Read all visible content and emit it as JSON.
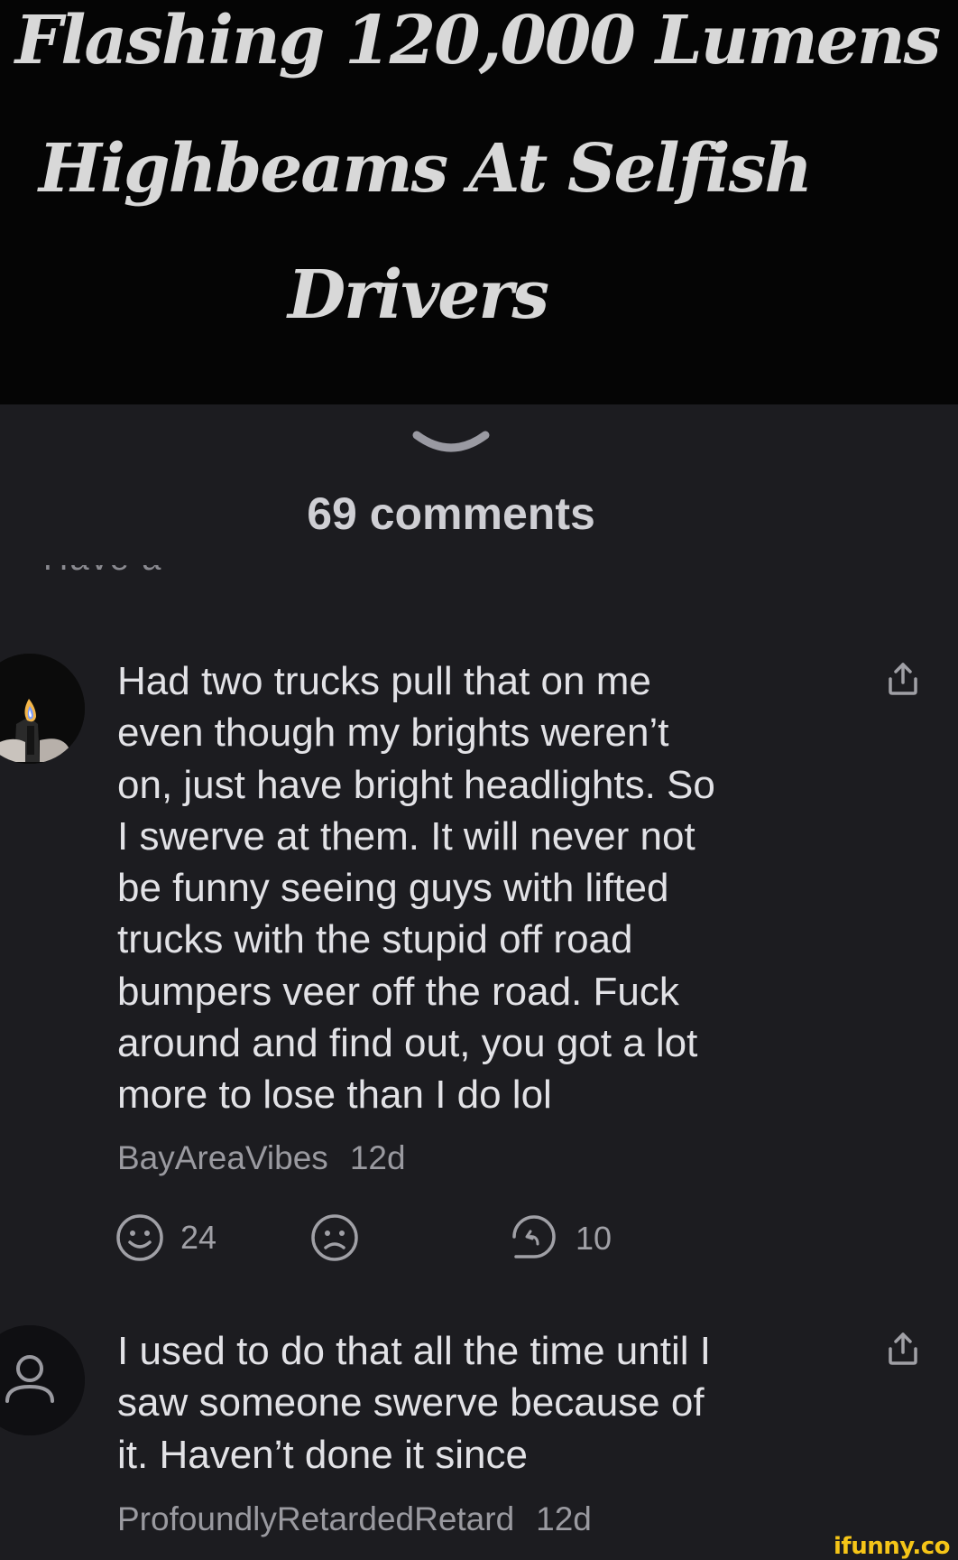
{
  "meme": {
    "line1": "Flashing 120,000 Lumens",
    "line2": "Highbeams At Selfish",
    "line3": "Drivers"
  },
  "comments_header": {
    "count_label": "69 comments",
    "partial_text": "Have a comment"
  },
  "comments": [
    {
      "text": "Had two trucks pull that on me\neven though my brights weren’t\non, just have bright headlights. So\nI swerve at them. It will never not\nbe funny seeing guys with lifted\ntrucks with the stupid off road\nbumpers veer off the road. Fuck\naround and find out, you got a lot\nmore to lose than I do lol",
      "username": "BayAreaVibes",
      "age": "12d",
      "likes": "24",
      "replies": "10"
    },
    {
      "text": "I used to do that all the time until I\nsaw someone swerve because of\nit. Haven’t done it since",
      "username": "ProfoundlyRetardedRetard",
      "age": "12d"
    }
  ],
  "watermark": "ifunny.co",
  "icons": {
    "handle": "chevron-down-icon",
    "share": "share-icon",
    "like": "smile-icon",
    "dislike": "frown-icon",
    "reply": "reply-icon",
    "default_avatar": "user-icon"
  },
  "colors": {
    "sheet_background": "#1c1c20",
    "header_background": "#050505",
    "watermark": "#f5c518"
  }
}
